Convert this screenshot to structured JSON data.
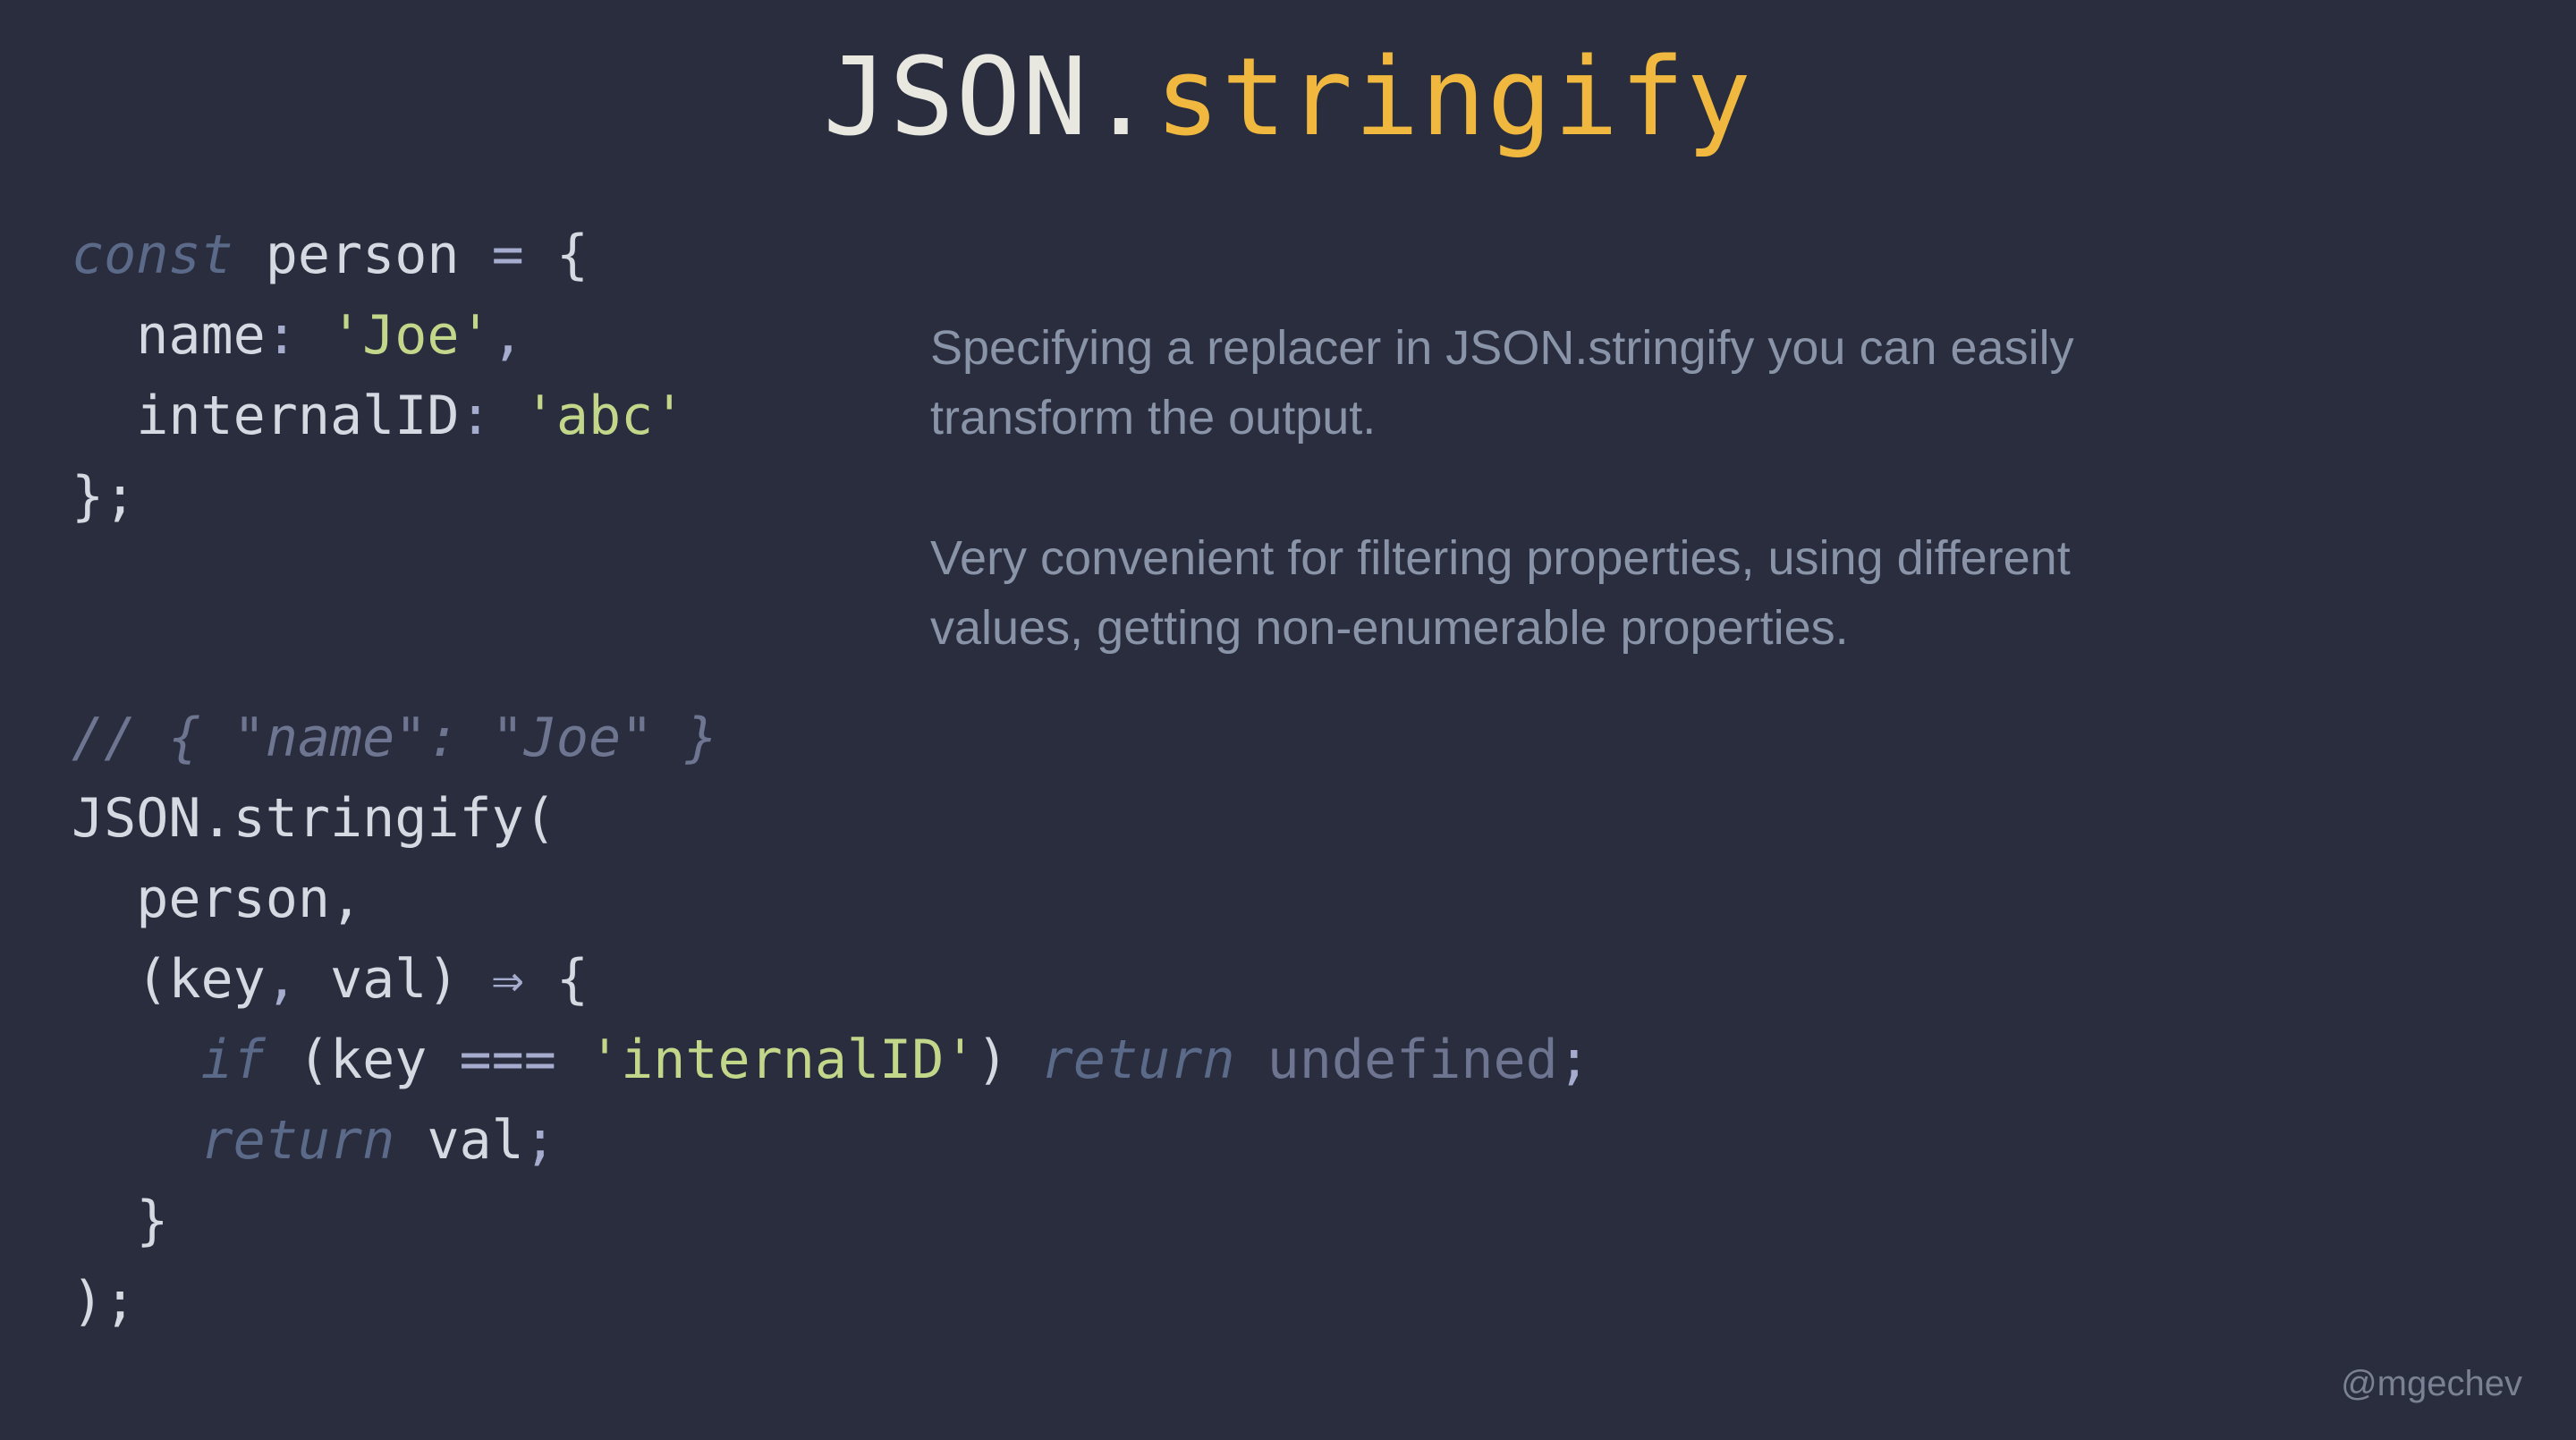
{
  "title": {
    "part1": "JSON.",
    "part2": "stringify"
  },
  "code": {
    "l1_const": "const",
    "l1_var": " person ",
    "l1_eq": "=",
    "l1_brace": " {",
    "l2_indent": "  ",
    "l2_name": "name",
    "l2_colon": ": ",
    "l2_str": "'Joe'",
    "l2_comma": ",",
    "l3_indent": "  ",
    "l3_key": "internalID",
    "l3_colon": ": ",
    "l3_str": "'abc'",
    "l4_close": "};",
    "l6_comment": "// { \"name\": \"Joe\" }",
    "l7_json": "JSON.stringify(",
    "l8_indent": "  ",
    "l8_arg": "person,",
    "l9_indent": "  ",
    "l9_paren_open": "(",
    "l9_key": "key",
    "l9_comma": ", ",
    "l9_val": "val",
    "l9_paren_close": ") ",
    "l9_arrow": "⇒",
    "l9_brace": " {",
    "l10_indent": "    ",
    "l10_if": "if",
    "l10_space": " ",
    "l10_paren_open": "(",
    "l10_key": "key ",
    "l10_eq": "===",
    "l10_space2": " ",
    "l10_str": "'internalID'",
    "l10_paren_close": ") ",
    "l10_return": "return",
    "l10_space3": " ",
    "l10_undef": "undefined",
    "l10_semi": ";",
    "l11_indent": "    ",
    "l11_return": "return",
    "l11_space": " ",
    "l11_val": "val",
    "l11_semi": ";",
    "l12_indent": "  ",
    "l12_close": "}",
    "l13_close": ");"
  },
  "description": {
    "p1": "Specifying a replacer in JSON.stringify you can easily transform the output.",
    "p2": "Very convenient for filtering properties, using different values, getting non-enumerable properties."
  },
  "handle": "@mgechev"
}
